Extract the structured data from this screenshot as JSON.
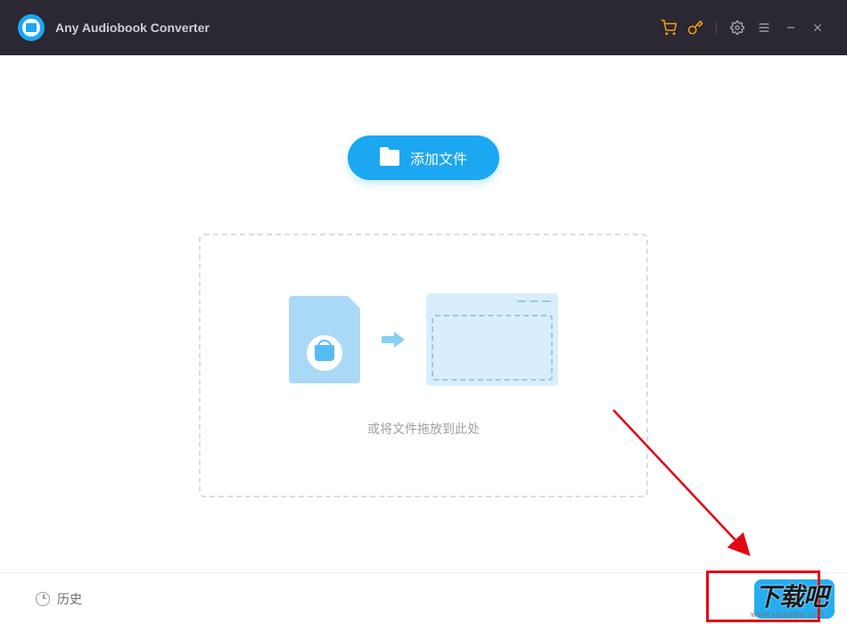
{
  "app": {
    "title": "Any Audiobook Converter"
  },
  "titlebar": {
    "icons": {
      "cart": "cart-icon",
      "key": "key-icon",
      "settings": "gear-icon",
      "menu": "menu-icon",
      "minimize": "minimize-icon",
      "close": "close-icon"
    }
  },
  "main": {
    "add_button_label": "添加文件",
    "dropzone_text": "或将文件拖放到此处"
  },
  "footer": {
    "history_label": "历史"
  },
  "watermark": {
    "text": "下载吧",
    "url": "www.xiazaiba.com"
  },
  "colors": {
    "titlebar_bg": "#2b2733",
    "accent": "#1ba7f1",
    "accent_orange": "#f4a10a",
    "callout_red": "#e30613"
  }
}
